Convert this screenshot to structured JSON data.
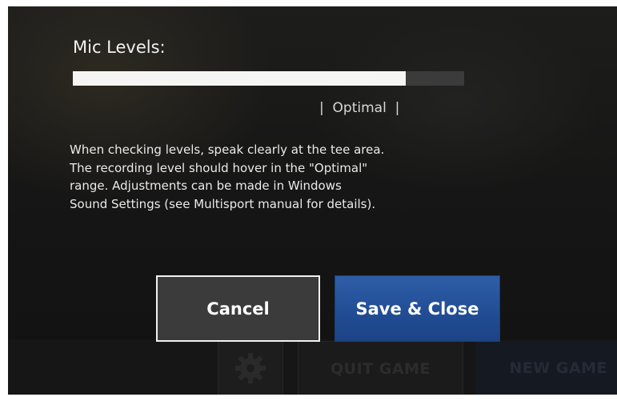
{
  "dialog": {
    "title": "Mic Levels:",
    "level_fraction": 0.85,
    "optimal_label": "|  Optimal  |",
    "help_lines": [
      "When checking levels, speak clearly at the tee area.",
      "The recording level should hover in the \"Optimal\"",
      "range. Adjustments can be made in Windows",
      "Sound Settings (see Multisport manual for details)."
    ],
    "cancel_label": "Cancel",
    "save_label": "Save & Close"
  },
  "bottom_bar": {
    "settings_icon": "gear-icon",
    "quit_label": "QUIT GAME",
    "new_label": "NEW GAME"
  },
  "colors": {
    "background": "#141414",
    "meter_fill": "#f5f5f3",
    "meter_track": "#3b3b3b",
    "save_button": "#2356a0",
    "cancel_button": "#3b3b3b"
  }
}
